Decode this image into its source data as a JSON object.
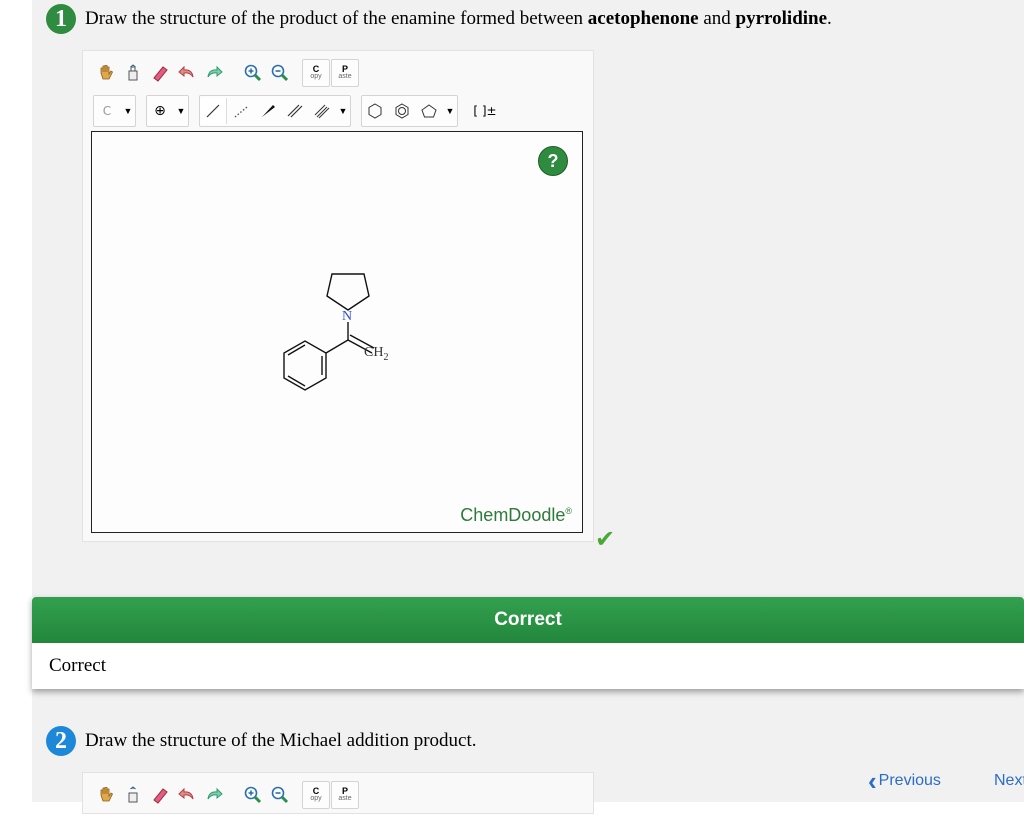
{
  "q1": {
    "number": "1",
    "text_prefix": "Draw the structure of the product of the enamine formed between ",
    "bold1": "acetophenone",
    "mid": " and ",
    "bold2": "pyrrolidine",
    "suffix": "."
  },
  "toolbar": {
    "copy_top": "C",
    "copy_bottom": "opy",
    "paste_top": "P",
    "paste_bottom": "aste",
    "element": "C",
    "charge": "⊕",
    "template": "[ ]±"
  },
  "editor": {
    "help": "?",
    "brand": "ChemDoodle",
    "brand_mark": "®",
    "atom_n": "N",
    "atom_ch2": "CH",
    "atom_ch2_sub": "2"
  },
  "feedback": {
    "header": "Correct",
    "body": "Correct"
  },
  "q2": {
    "number": "2",
    "text": "Draw the structure of the Michael addition product."
  },
  "nav": {
    "previous": "Previous",
    "next": "Next"
  },
  "colors": {
    "q1_badge": "#2e8b3f",
    "q2_badge": "#1e88d8",
    "correct_green": "#22873b",
    "link_blue": "#2a6dc5"
  }
}
